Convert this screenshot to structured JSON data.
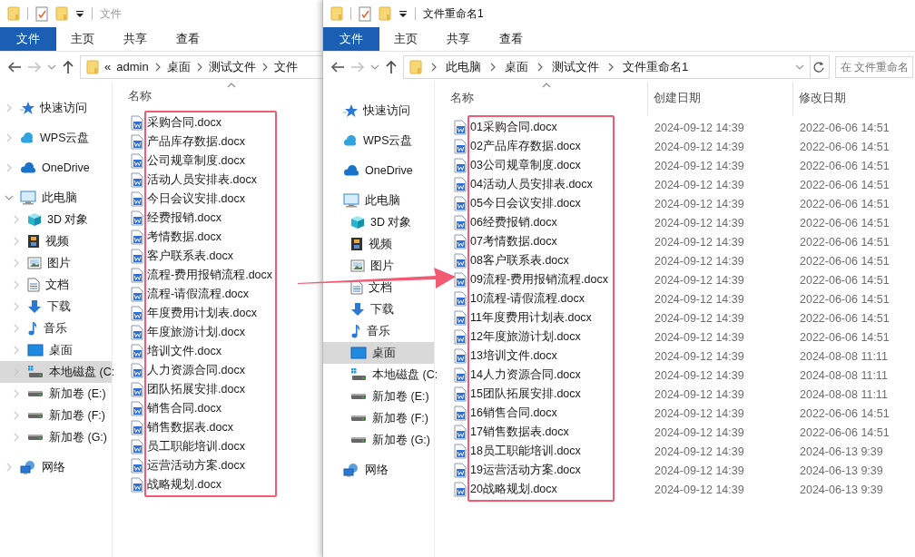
{
  "windows": [
    {
      "title": "文件",
      "active": false,
      "ribbon_tabs": [
        {
          "label": "文件",
          "selected": true
        },
        {
          "label": "主页",
          "selected": false
        },
        {
          "label": "共享",
          "selected": false
        },
        {
          "label": "查看",
          "selected": false
        }
      ],
      "address": {
        "overflow": "«",
        "crumbs": [
          "admin",
          "桌面",
          "测试文件",
          "文件"
        ]
      },
      "chevrons_visible": true,
      "nav": [
        {
          "label": "快速访问",
          "kind": "star",
          "selected": false
        },
        {
          "label": "WPS云盘",
          "kind": "cloud",
          "selected": false
        },
        {
          "label": "OneDrive",
          "kind": "onedrive",
          "selected": false
        },
        {
          "label": "此电脑",
          "kind": "pc",
          "selected": false,
          "expanded": true,
          "children": [
            {
              "label": "3D 对象",
              "kind": "cube",
              "selected": false
            },
            {
              "label": "视频",
              "kind": "film",
              "selected": false
            },
            {
              "label": "图片",
              "kind": "picture",
              "selected": false
            },
            {
              "label": "文档",
              "kind": "document",
              "selected": false
            },
            {
              "label": "下载",
              "kind": "download",
              "selected": false
            },
            {
              "label": "音乐",
              "kind": "music",
              "selected": false
            },
            {
              "label": "桌面",
              "kind": "desktop",
              "selected": false
            },
            {
              "label": "本地磁盘 (C:",
              "kind": "system-drive",
              "selected": true
            },
            {
              "label": "新加卷 (E:)",
              "kind": "drive",
              "selected": false
            },
            {
              "label": "新加卷 (F:)",
              "kind": "drive",
              "selected": false
            },
            {
              "label": "新加卷 (G:)",
              "kind": "drive",
              "selected": false
            }
          ]
        },
        {
          "label": "网络",
          "kind": "network",
          "selected": false
        }
      ],
      "columns": [
        {
          "label": "名称",
          "sorted": true
        }
      ],
      "highlighted": true,
      "files": [
        {
          "name": "采购合同.docx"
        },
        {
          "name": "产品库存数据.docx"
        },
        {
          "name": "公司规章制度.docx"
        },
        {
          "name": "活动人员安排表.docx"
        },
        {
          "name": "今日会议安排.docx"
        },
        {
          "name": "经费报销.docx"
        },
        {
          "name": "考情数据.docx"
        },
        {
          "name": "客户联系表.docx"
        },
        {
          "name": "流程-费用报销流程.docx"
        },
        {
          "name": "流程-请假流程.docx"
        },
        {
          "name": "年度费用计划表.docx"
        },
        {
          "name": "年度旅游计划.docx"
        },
        {
          "name": "培训文件.docx"
        },
        {
          "name": "人力资源合同.docx"
        },
        {
          "name": "团队拓展安排.docx"
        },
        {
          "name": "销售合同.docx"
        },
        {
          "name": "销售数据表.docx"
        },
        {
          "name": "员工职能培训.docx"
        },
        {
          "name": "运营活动方案.docx"
        },
        {
          "name": "战略规划.docx"
        }
      ]
    },
    {
      "title": "文件重命名1",
      "active": true,
      "ribbon_tabs": [
        {
          "label": "文件",
          "selected": true
        },
        {
          "label": "主页",
          "selected": false
        },
        {
          "label": "共享",
          "selected": false
        },
        {
          "label": "查看",
          "selected": false
        }
      ],
      "address": {
        "crumbs": [
          "此电脑",
          "桌面",
          "测试文件",
          "文件重命名1"
        ]
      },
      "search": {
        "placeholder": "在 文件重命名"
      },
      "chevrons_visible": false,
      "nav": [
        {
          "label": "快速访问",
          "kind": "star",
          "selected": false
        },
        {
          "label": "WPS云盘",
          "kind": "cloud",
          "selected": false
        },
        {
          "label": "OneDrive",
          "kind": "onedrive",
          "selected": false
        },
        {
          "label": "此电脑",
          "kind": "pc",
          "selected": false,
          "children": [
            {
              "label": "3D 对象",
              "kind": "cube",
              "selected": false
            },
            {
              "label": "视频",
              "kind": "film",
              "selected": false
            },
            {
              "label": "图片",
              "kind": "picture",
              "selected": false
            },
            {
              "label": "文档",
              "kind": "document",
              "selected": false
            },
            {
              "label": "下载",
              "kind": "download",
              "selected": false
            },
            {
              "label": "音乐",
              "kind": "music",
              "selected": false
            },
            {
              "label": "桌面",
              "kind": "desktop",
              "selected": true
            },
            {
              "label": "本地磁盘 (C:",
              "kind": "system-drive",
              "selected": false
            },
            {
              "label": "新加卷 (E:)",
              "kind": "drive",
              "selected": false
            },
            {
              "label": "新加卷 (F:)",
              "kind": "drive",
              "selected": false
            },
            {
              "label": "新加卷 (G:)",
              "kind": "drive",
              "selected": false
            }
          ]
        },
        {
          "label": "网络",
          "kind": "network",
          "selected": false
        }
      ],
      "columns": [
        {
          "label": "名称",
          "sorted": true
        },
        {
          "label": "创建日期",
          "sorted": false
        },
        {
          "label": "修改日期",
          "sorted": false
        }
      ],
      "highlighted": true,
      "files": [
        {
          "name": "01采购合同.docx",
          "created": "2024-09-12 14:39",
          "modified": "2022-06-06 14:51"
        },
        {
          "name": "02产品库存数据.docx",
          "created": "2024-09-12 14:39",
          "modified": "2022-06-06 14:51"
        },
        {
          "name": "03公司规章制度.docx",
          "created": "2024-09-12 14:39",
          "modified": "2022-06-06 14:51"
        },
        {
          "name": "04活动人员安排表.docx",
          "created": "2024-09-12 14:39",
          "modified": "2022-06-06 14:51"
        },
        {
          "name": "05今日会议安排.docx",
          "created": "2024-09-12 14:39",
          "modified": "2022-06-06 14:51"
        },
        {
          "name": "06经费报销.docx",
          "created": "2024-09-12 14:39",
          "modified": "2022-06-06 14:51"
        },
        {
          "name": "07考情数据.docx",
          "created": "2024-09-12 14:39",
          "modified": "2022-06-06 14:51"
        },
        {
          "name": "08客户联系表.docx",
          "created": "2024-09-12 14:39",
          "modified": "2022-06-06 14:51"
        },
        {
          "name": "09流程-费用报销流程.docx",
          "created": "2024-09-12 14:39",
          "modified": "2022-06-06 14:51"
        },
        {
          "name": "10流程-请假流程.docx",
          "created": "2024-09-12 14:39",
          "modified": "2022-06-06 14:51"
        },
        {
          "name": "11年度费用计划表.docx",
          "created": "2024-09-12 14:39",
          "modified": "2022-06-06 14:51"
        },
        {
          "name": "12年度旅游计划.docx",
          "created": "2024-09-12 14:39",
          "modified": "2022-06-06 14:51"
        },
        {
          "name": "13培训文件.docx",
          "created": "2024-09-12 14:39",
          "modified": "2024-08-08 11:11"
        },
        {
          "name": "14人力资源合同.docx",
          "created": "2024-09-12 14:39",
          "modified": "2024-08-08 11:11"
        },
        {
          "name": "15团队拓展安排.docx",
          "created": "2024-09-12 14:39",
          "modified": "2024-08-08 11:11"
        },
        {
          "name": "16销售合同.docx",
          "created": "2024-09-12 14:39",
          "modified": "2022-06-06 14:51"
        },
        {
          "name": "17销售数据表.docx",
          "created": "2024-09-12 14:39",
          "modified": "2022-06-06 14:51"
        },
        {
          "name": "18员工职能培训.docx",
          "created": "2024-09-12 14:39",
          "modified": "2024-06-13 9:39"
        },
        {
          "name": "19运营活动方案.docx",
          "created": "2024-09-12 14:39",
          "modified": "2024-06-13 9:39"
        },
        {
          "name": "20战略规划.docx",
          "created": "2024-09-12 14:39",
          "modified": "2024-06-13 9:39"
        }
      ]
    }
  ],
  "annotation_arrow": true
}
